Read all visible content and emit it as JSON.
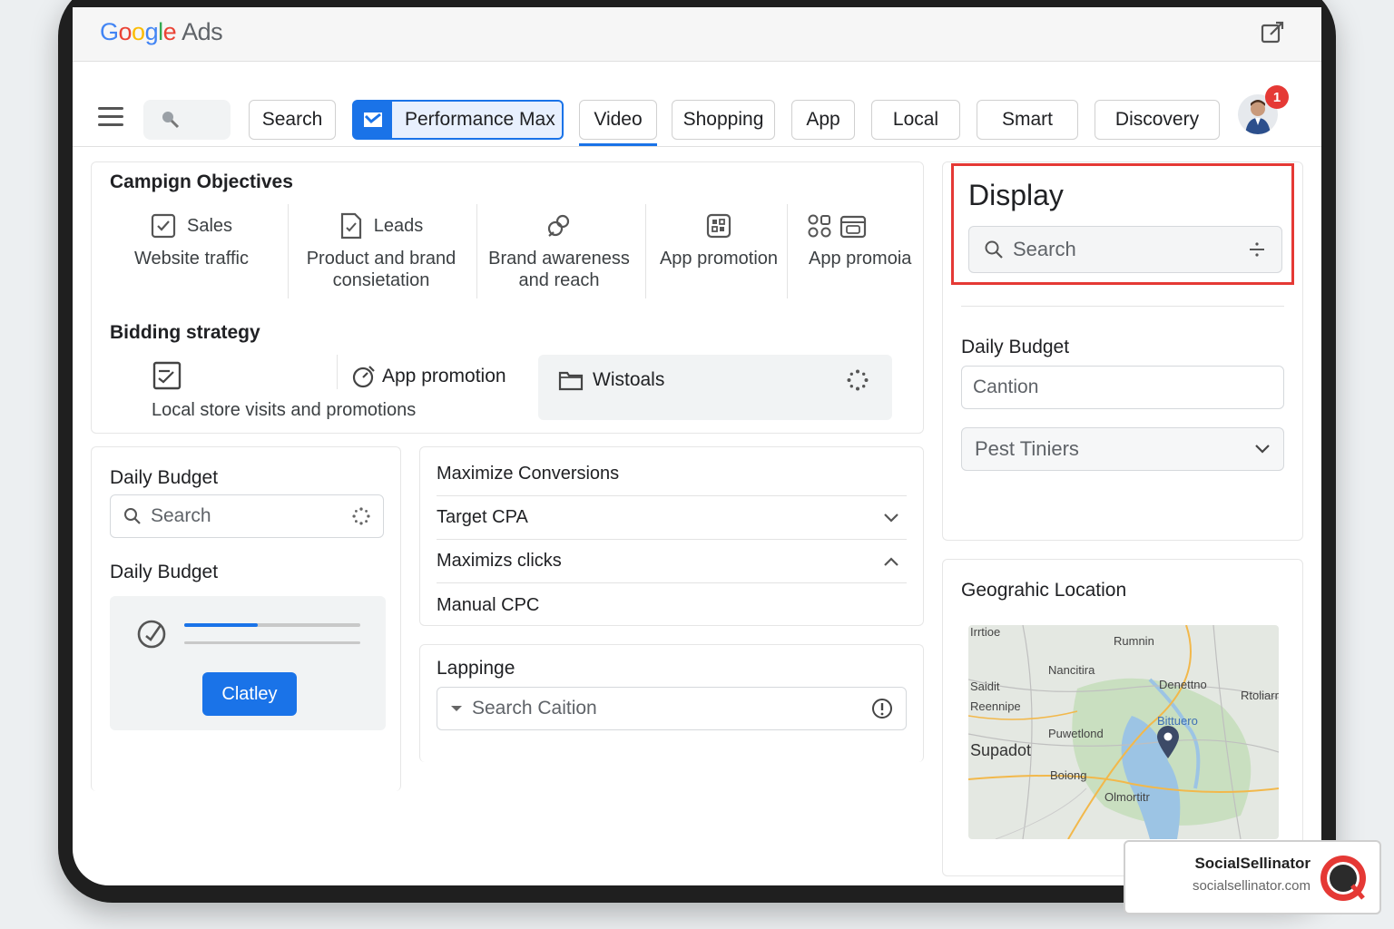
{
  "app": {
    "name_letters": [
      "G",
      "o",
      "o",
      "g",
      "l",
      "e"
    ],
    "suffix": "Ads"
  },
  "nav": {
    "tabs": [
      {
        "label": "Search"
      },
      {
        "label": "Performance Max",
        "active": true
      },
      {
        "label": "Video",
        "underlined": true
      },
      {
        "label": "Shopping"
      },
      {
        "label": "App"
      },
      {
        "label": "Local"
      },
      {
        "label": "Smart"
      },
      {
        "label": "Discovery"
      }
    ],
    "notification_count": "1"
  },
  "objectives": {
    "title": "Campign Objectives",
    "items": [
      {
        "label": "Sales",
        "sub": "Website traffic",
        "icon": "check-square-icon"
      },
      {
        "label": "Leads",
        "sub": "Product and brand consietation",
        "icon": "document-icon"
      },
      {
        "label": "",
        "sub": "Brand awareness and reach",
        "icon": "megaphone-icon"
      },
      {
        "label": "",
        "sub": "App promotion",
        "icon": "app-grid-icon"
      },
      {
        "label": "",
        "sub": "App promoia",
        "icon": "app-calendar-icon"
      }
    ]
  },
  "bidding": {
    "title": "Bidding strategy",
    "local_label": "Local store visits and promotions",
    "app_promotion": "App promotion",
    "wistoals": "Wistoals"
  },
  "budget_left": {
    "title1": "Daily Budget",
    "search_placeholder": "Search",
    "title2": "Daily Budget",
    "button": "Clatley",
    "progress": 0.42
  },
  "bid_options": [
    "Maximize Conversions",
    "Target CPA",
    "Maximizs clicks",
    "Manual CPC"
  ],
  "lappinge": {
    "title": "Lappinge",
    "placeholder": "Search Caition"
  },
  "display": {
    "title": "Display",
    "search_placeholder": "Search"
  },
  "budget_right": {
    "title": "Daily Budget",
    "input_placeholder": "Cantion",
    "select_value": "Pest Tiniers"
  },
  "geo": {
    "title": "Geograhic Location",
    "places": [
      "Rumnin",
      "Nancitira",
      "Denettno",
      "Rtoliarr",
      "Saidit",
      "Reennipe",
      "Puwetlond",
      "Bittuero",
      "Supadot",
      "Boiong",
      "Olmortitr",
      "Irrtioe"
    ]
  },
  "watermark": {
    "name": "SocialSellinator",
    "url": "socialsellinator.com"
  },
  "colors": {
    "accent": "#1a73e8",
    "highlight": "#e53935"
  }
}
